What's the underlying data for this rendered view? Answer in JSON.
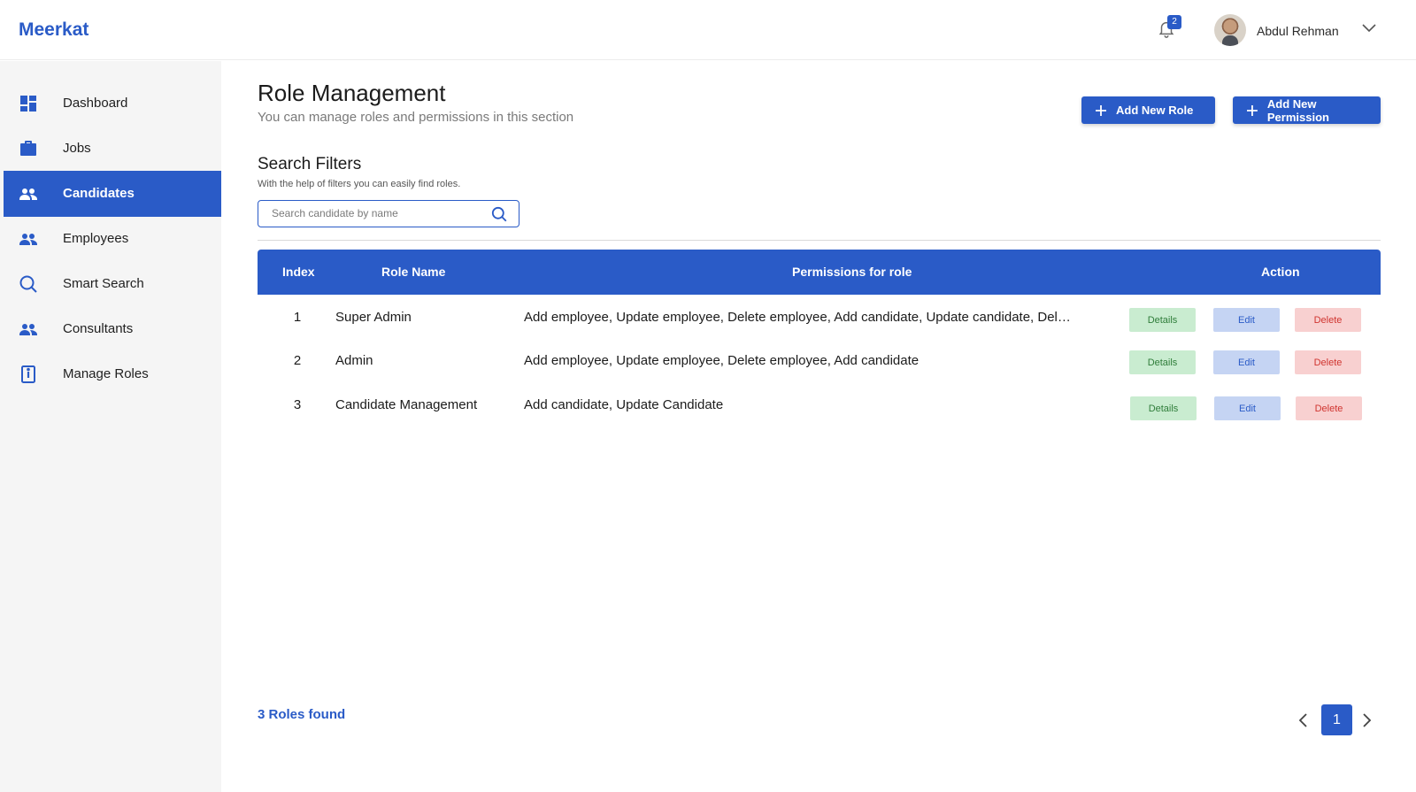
{
  "app": {
    "logo": "Meerkat"
  },
  "header": {
    "notification_count": "2",
    "user_name": "Abdul Rehman"
  },
  "sidebar": {
    "items": [
      {
        "label": "Dashboard",
        "icon": "dashboard-icon"
      },
      {
        "label": "Jobs",
        "icon": "briefcase-icon"
      },
      {
        "label": "Candidates",
        "icon": "people-icon",
        "active": true
      },
      {
        "label": "Employees",
        "icon": "people-icon"
      },
      {
        "label": "Smart Search",
        "icon": "search-icon"
      },
      {
        "label": "Consultants",
        "icon": "people-icon"
      },
      {
        "label": "Manage Roles",
        "icon": "id-card-icon"
      }
    ]
  },
  "main": {
    "title": "Role Management",
    "subtitle": "You can manage roles and permissions in this section",
    "add_role_label": "Add New Role",
    "add_permission_label": "Add New Permission",
    "filters_title": "Search Filters",
    "filters_subtitle": "With the help of filters you can easily find roles.",
    "search_placeholder": "Search candidate by name"
  },
  "table": {
    "columns": [
      "Index",
      "Role Name",
      "Permissions for role",
      "Action"
    ],
    "rows": [
      {
        "index": "1",
        "role": "Super Admin",
        "permissions": "Add employee, Update employee, Delete employee, Add candidate, Update candidate, Delete candidate"
      },
      {
        "index": "2",
        "role": "Admin",
        "permissions": "Add employee, Update employee, Delete employee, Add candidate"
      },
      {
        "index": "3",
        "role": "Candidate Management",
        "permissions": "Add candidate, Update Candidate"
      }
    ],
    "actions": {
      "details": "Details",
      "edit": "Edit",
      "delete": "Delete"
    }
  },
  "footer": {
    "found_text": "3 Roles found",
    "current_page": "1"
  },
  "colors": {
    "primary": "#2a5bc7",
    "details_bg": "#c9ecd0",
    "edit_bg": "#c5d4f3",
    "delete_bg": "#f8d0d0"
  }
}
